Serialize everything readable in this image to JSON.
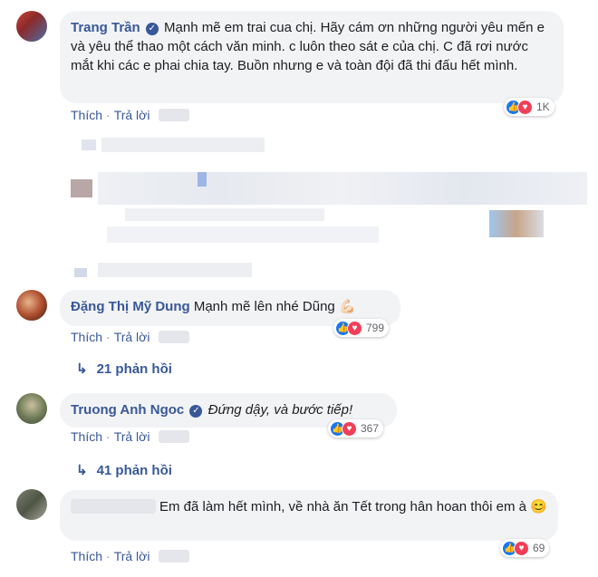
{
  "comments": [
    {
      "author": "Trang Trần",
      "text": "Mạnh mẽ em trai cua chị. Hãy cám ơn những người yêu mến e và yêu thể thao một cách văn minh. c luôn theo sát e của chị. C đã rơi nước mắt khi các e phai chia tay. Buồn nhưng e và toàn đội đã thi đấu hết mình.",
      "verified": true,
      "like_label": "Thích",
      "reply_label": "Trả lời",
      "reactions": "1K"
    },
    {
      "author": "Đặng Thị Mỹ Dung",
      "text": "Mạnh mẽ lên nhé Dũng",
      "emoji": "💪🏻",
      "like_label": "Thích",
      "reply_label": "Trả lời",
      "reactions": "799",
      "replies": "21 phản hồi"
    },
    {
      "author": "Truong Anh Ngoc",
      "text": "Đứng dậy, và bước tiếp!",
      "verified": true,
      "like_label": "Thích",
      "reply_label": "Trả lời",
      "reactions": "367",
      "replies": "41 phản hồi"
    },
    {
      "author": "",
      "text": "Em đã làm hết mình, về nhà ăn Tết trong hân hoan thôi em à",
      "emoji": "😊",
      "like_label": "Thích",
      "reply_label": "Trả lời",
      "reactions": "69"
    }
  ],
  "colors": {
    "link": "#385898",
    "bubble": "#f2f3f5",
    "like": "#1877f2",
    "love": "#f33e58"
  },
  "icons": [
    "verified-badge-icon",
    "like-reaction-icon",
    "love-reaction-icon",
    "reply-arrow-icon"
  ]
}
